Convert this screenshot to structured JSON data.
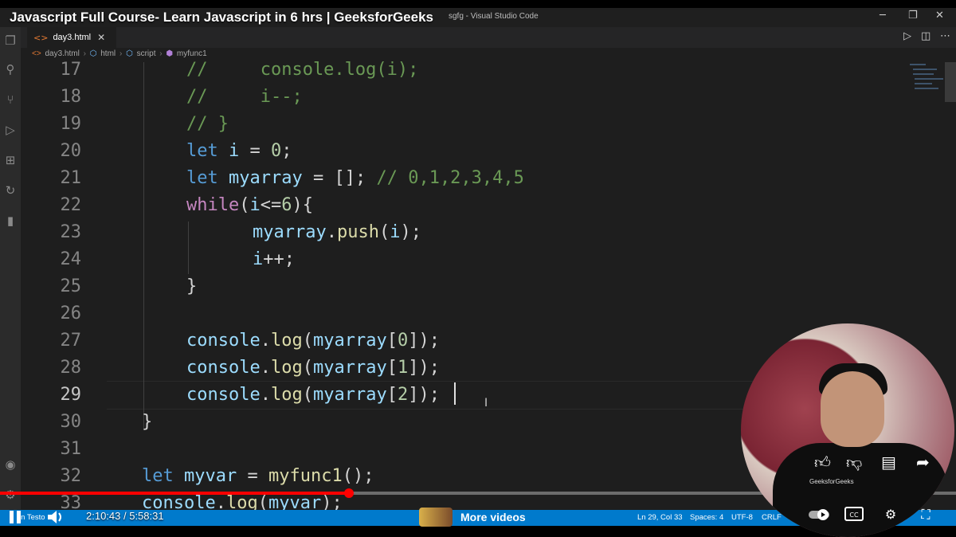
{
  "video": {
    "title": "Javascript Full Course- Learn Javascript in 6 hrs | GeeksforGeeks",
    "current_time": "2:10:43",
    "duration": "5:58:31",
    "time_display": "2:10:43 / 5:58:31",
    "progress_fraction": 0.365,
    "more_videos_label": "More videos",
    "more_videos_thumb_text": "JavaScript"
  },
  "vscode": {
    "window_title_fragment": "sgfg - Visual Studio Code",
    "tab": {
      "name": "day3.html",
      "close": "✕"
    },
    "breadcrumb": [
      "day3.html",
      "html",
      "script",
      "myfunc1"
    ],
    "status": {
      "left": "in Testo",
      "position": "Ln 29, Col 33",
      "spaces": "Spaces: 4",
      "encoding": "UTF-8",
      "eol": "CRLF"
    },
    "code_lines": [
      {
        "num": "17",
        "text": "//     console.log(i);"
      },
      {
        "num": "18",
        "text": "//     i--;"
      },
      {
        "num": "19",
        "text": "// }"
      },
      {
        "num": "20",
        "text": "let i = 0;"
      },
      {
        "num": "21",
        "text": "let myarray = []; // 0,1,2,3,4,5"
      },
      {
        "num": "22",
        "text": "while(i<=6){"
      },
      {
        "num": "23",
        "text": "myarray.push(i);"
      },
      {
        "num": "24",
        "text": "i++;"
      },
      {
        "num": "25",
        "text": "}"
      },
      {
        "num": "26",
        "text": ""
      },
      {
        "num": "27",
        "text": "console.log(myarray[0]);"
      },
      {
        "num": "28",
        "text": "console.log(myarray[1]);"
      },
      {
        "num": "29",
        "text": "console.log(myarray[2]);"
      },
      {
        "num": "30",
        "text": "}"
      },
      {
        "num": "31",
        "text": ""
      },
      {
        "num": "32",
        "text": "let myvar = myfunc1();"
      },
      {
        "num": "33",
        "text": "console.log(myvar);"
      }
    ],
    "activity_icons": [
      "files-icon",
      "search-icon",
      "source-control-icon",
      "run-debug-icon",
      "extensions-icon",
      "remote-icon",
      "chart-icon",
      "account-icon",
      "settings-gear-icon"
    ]
  },
  "webcam": {
    "shirt_text": "GeeksforGeeks"
  },
  "colors": {
    "status_bar": "#007acc",
    "progress": "#ff0000",
    "editor_bg": "#1e1e1e"
  }
}
